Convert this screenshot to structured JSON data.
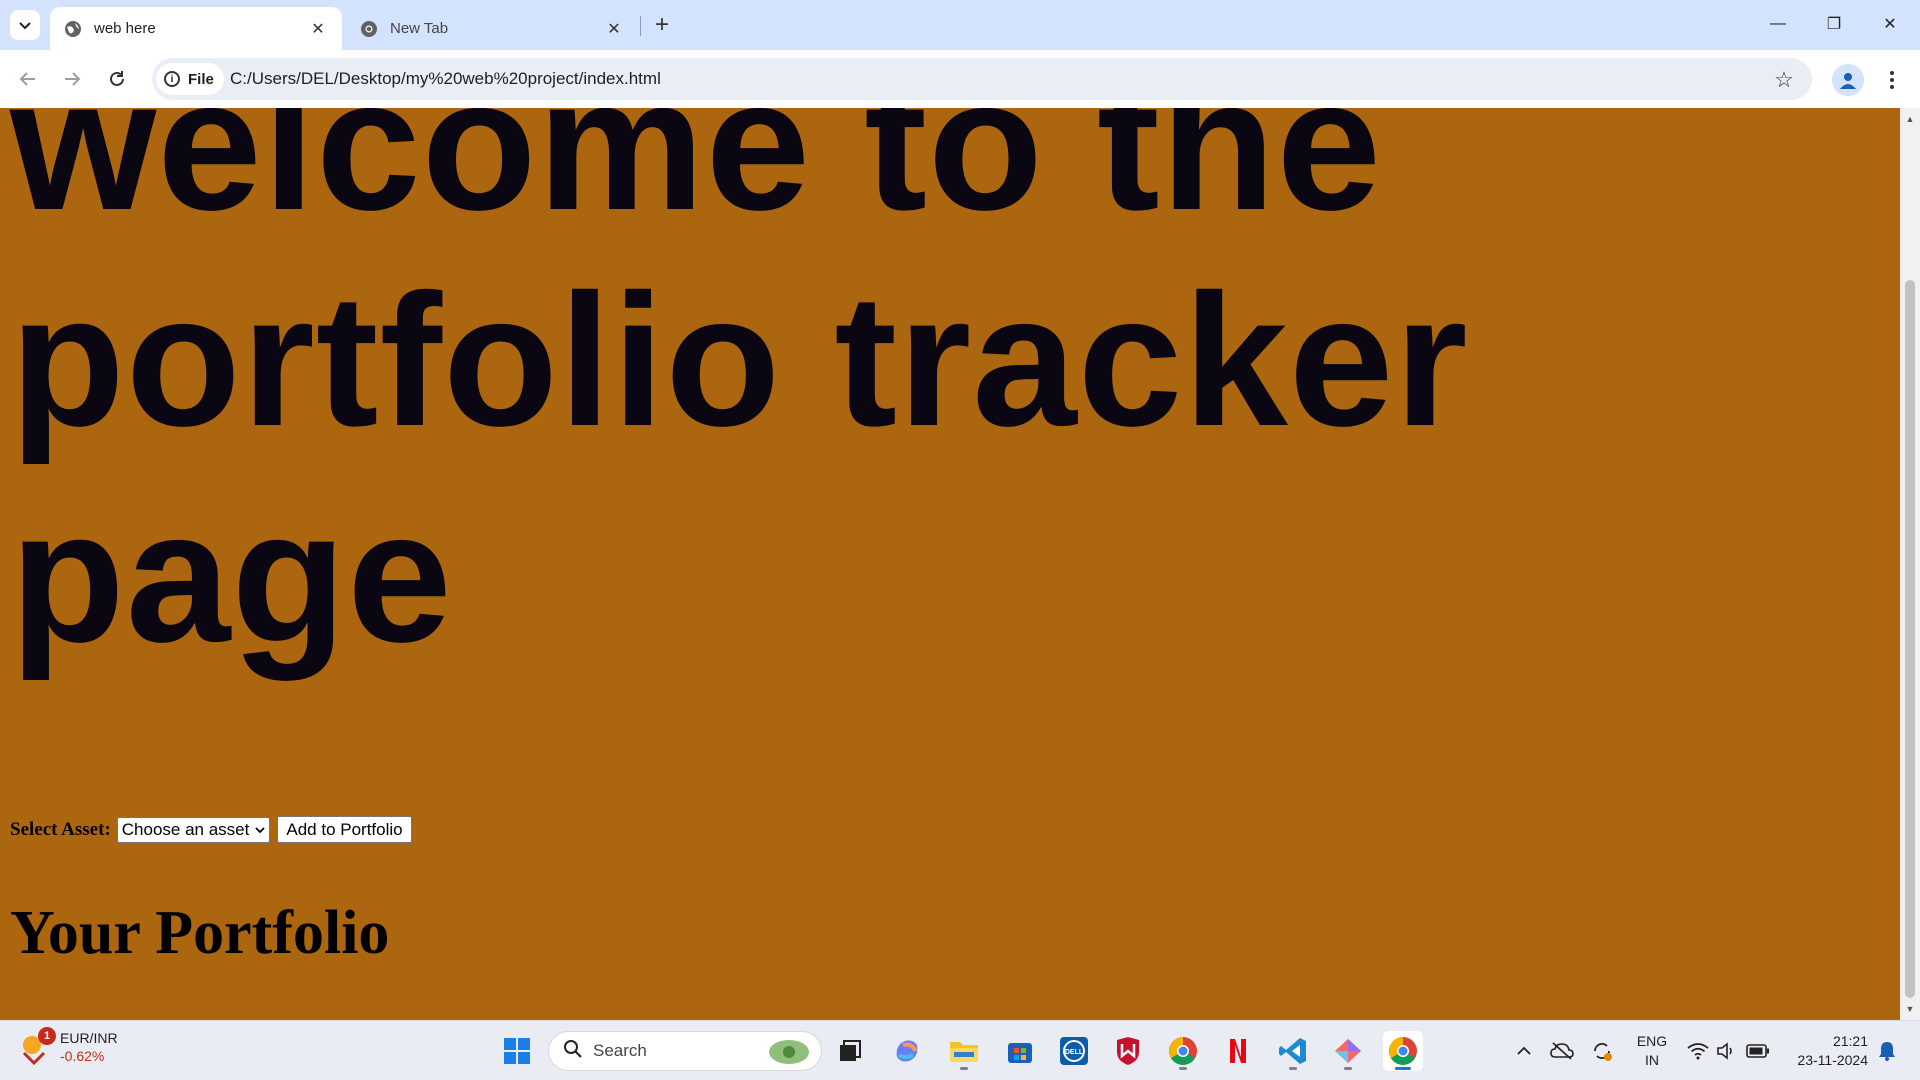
{
  "browser": {
    "tabs": [
      {
        "title": "web here",
        "active": true
      },
      {
        "title": "New Tab",
        "active": false
      }
    ],
    "address": {
      "chip_label": "File",
      "url": "C:/Users/DEL/Desktop/my%20web%20project/index.html"
    },
    "window_controls": {
      "minimize": "—",
      "restore": "❐",
      "close": "✕"
    }
  },
  "page": {
    "heading": "welcome to the portfolio tracker page",
    "select_label": "Select Asset:",
    "select_value": "Choose an asset",
    "add_button": "Add to Portfolio",
    "portfolio_heading": "Your Portfolio",
    "background_color": "#ac660f"
  },
  "taskbar": {
    "widget": {
      "badge": "1",
      "pair": "EUR/INR",
      "change": "-0.62%"
    },
    "search_placeholder": "Search",
    "language": {
      "line1": "ENG",
      "line2": "IN"
    },
    "clock": {
      "time": "21:21",
      "date": "23-11-2024"
    }
  }
}
